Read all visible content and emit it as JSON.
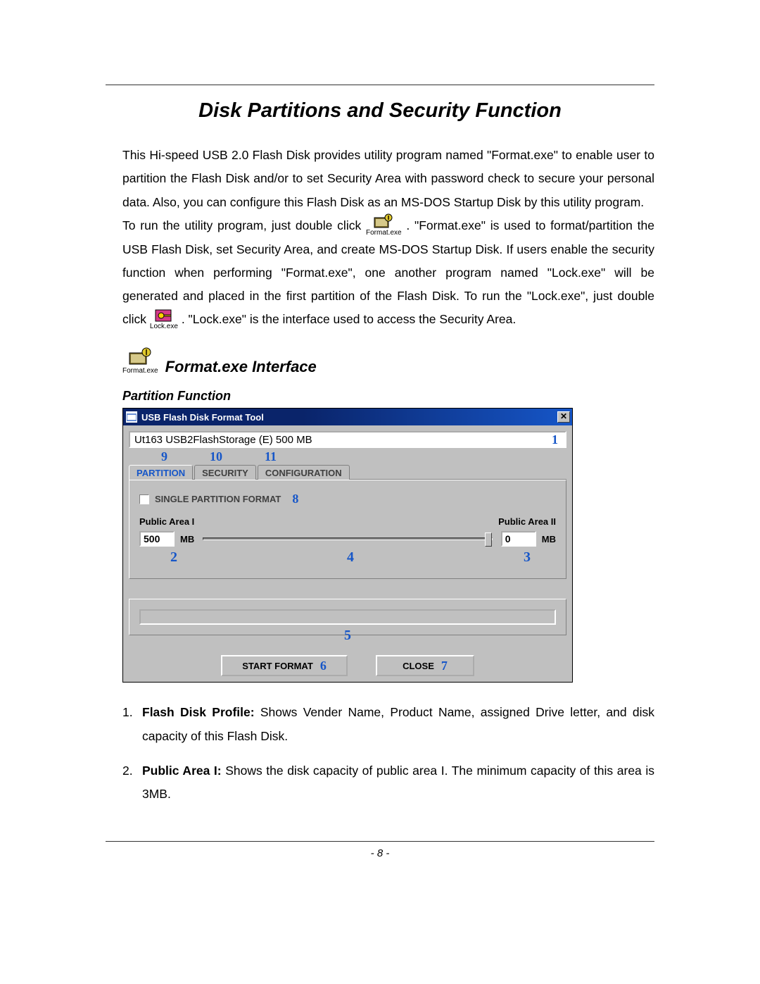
{
  "title": "Disk Partitions and Security Function",
  "para1": "This Hi-speed USB 2.0 Flash Disk provides utility program named \"Format.exe\" to enable user to partition the Flash Disk and/or to set Security Area with password check to secure your personal data. Also, you can configure this Flash Disk as an MS-DOS Startup Disk by this utility program.",
  "para2a": "To run the utility program, just double click",
  "icon_format_label": "Format.exe",
  "para2b": ". \"Format.exe\" is used to format/partition the USB Flash Disk, set Security Area, and create MS-DOS Startup Disk. If users enable the security function when performing \"Format.exe\", one another program named \"Lock.exe\" will be generated and placed in the first partition of the Flash Disk. To run the \"Lock.exe\", just double click",
  "icon_lock_label": "Lock.exe",
  "para2c": ". \"Lock.exe\" is the interface used to access the Security Area.",
  "subtitle": "Format.exe Interface",
  "subsub": "Partition Function",
  "dialog": {
    "title": "USB Flash Disk Format Tool",
    "profile": "Ut163   USB2FlashStorage (E)  500 MB",
    "tabs": {
      "partition": "PARTITION",
      "security": "SECURITY",
      "configuration": "CONFIGURATION"
    },
    "single_partition_label": "SINGLE PARTITION FORMAT",
    "area1_label": "Public Area I",
    "area2_label": "Public Area II",
    "area1_value": "500",
    "area2_value": "0",
    "unit": "MB",
    "start_label": "START FORMAT",
    "close_label": "CLOSE",
    "callouts": {
      "c1": "1",
      "c2": "2",
      "c3": "3",
      "c4": "4",
      "c5": "5",
      "c6": "6",
      "c7": "7",
      "c8": "8",
      "c9": "9",
      "c10": "10",
      "c11": "11"
    }
  },
  "list": {
    "n1": "1.",
    "t1_lead": "Flash Disk Profile:",
    "t1_rest": " Shows Vender Name, Product Name, assigned Drive letter, and disk capacity of this Flash Disk.",
    "n2": "2.",
    "t2_lead": "Public Area I:",
    "t2_rest": " Shows the disk capacity of public area I. The minimum capacity of this area is 3MB."
  },
  "page_number": "- 8 -"
}
